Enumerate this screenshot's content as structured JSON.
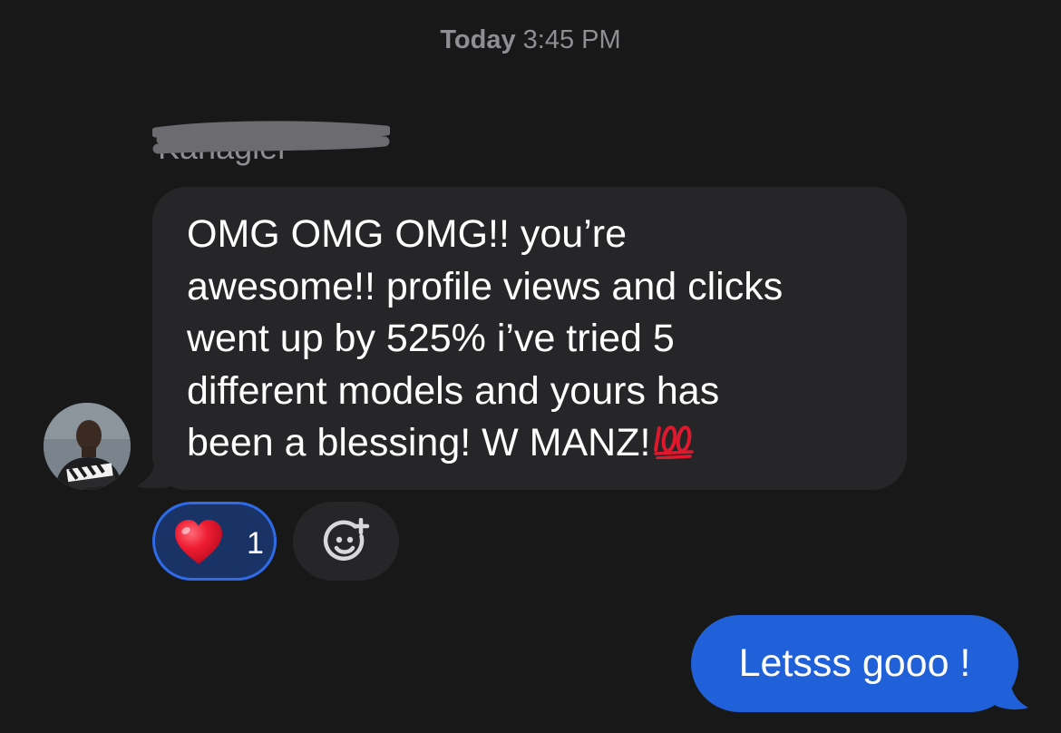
{
  "timestamp": {
    "day": "Today",
    "time": "3:45 PM"
  },
  "sender": {
    "name": "Kahagler",
    "name_redacted": true
  },
  "incoming_message": {
    "text": "OMG OMG OMG!! you’re\nawesome!! profile views and clicks\nwent up by 525% i’ve tried 5\ndifferent models and yours has\nbeen a blessing! W MANZ!",
    "trailing_emoji": "hundred-points-icon"
  },
  "reactions": {
    "heart_icon": "red-heart-icon",
    "heart_count": "1",
    "add_reaction_icon": "add-emoji-icon"
  },
  "outgoing_message": {
    "text": "Letsss gooo !"
  },
  "colors": {
    "background": "#181818",
    "incoming_bubble": "#262628",
    "outgoing_bubble": "#2060d8",
    "reaction_selected_bg": "#1a3367",
    "reaction_selected_border": "#2f6be8",
    "timestamp_text": "#8e8e93",
    "heart": "#e8102a",
    "hundred": "#e0182d"
  }
}
